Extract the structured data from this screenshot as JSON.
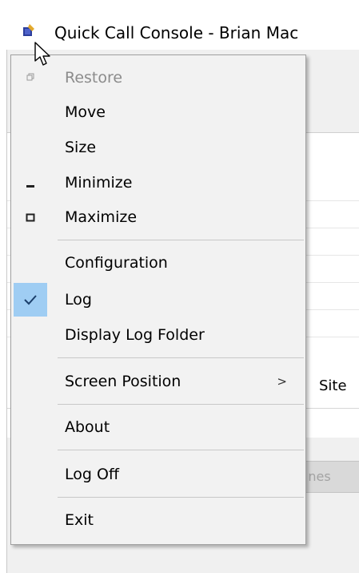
{
  "window": {
    "title": "Quick Call Console - Brian Mac",
    "column_site_label": "Site",
    "disabled_button_label": "nes"
  },
  "menu": {
    "items": [
      {
        "label": "Restore",
        "icon": "restore-icon",
        "enabled": false
      },
      {
        "label": "Move",
        "enabled": true
      },
      {
        "label": "Size",
        "enabled": true
      },
      {
        "label": "Minimize",
        "icon": "minimize-icon",
        "enabled": true
      },
      {
        "label": "Maximize",
        "icon": "maximize-icon",
        "enabled": true
      },
      {
        "label": "Configuration",
        "enabled": true
      },
      {
        "label": "Log",
        "icon": "checkmark-icon",
        "checked": true,
        "enabled": true
      },
      {
        "label": "Display Log Folder",
        "enabled": true
      },
      {
        "label": "Screen Position",
        "submenu": true,
        "arrow": ">",
        "enabled": true
      },
      {
        "label": "About",
        "enabled": true
      },
      {
        "label": "Log Off",
        "enabled": true
      },
      {
        "label": "Exit",
        "enabled": true
      }
    ]
  },
  "colors": {
    "check_highlight": "#9fcdf3",
    "menu_background": "#f2f2f2",
    "disabled_text": "#8c8c8c"
  }
}
